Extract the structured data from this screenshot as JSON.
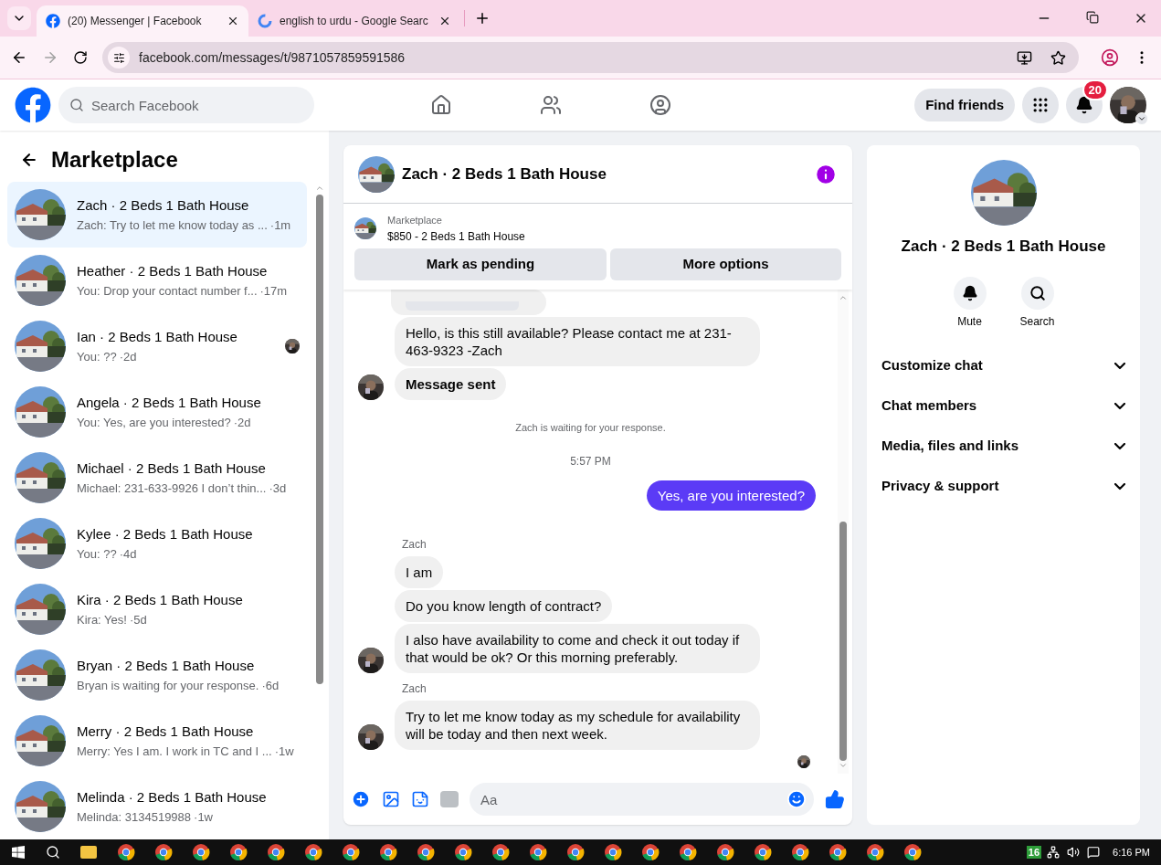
{
  "browser": {
    "tabs": [
      {
        "title": "(20) Messenger | Facebook",
        "selected": true
      },
      {
        "title": "english to urdu - Google Searc",
        "selected": false
      }
    ],
    "url": "facebook.com/messages/t/9871057859591586"
  },
  "header": {
    "search_placeholder": "Search Facebook",
    "find_friends": "Find friends",
    "notification_count": "20"
  },
  "sidebar": {
    "title": "Marketplace",
    "conversations": [
      {
        "name": "Zach · 2 Beds 1 Bath House",
        "preview": "Zach: Try to let me know today as ...",
        "time": "·1m",
        "selected": true,
        "read_receipt": false
      },
      {
        "name": "Heather · 2 Beds 1 Bath House",
        "preview": "You: Drop your contact number f...",
        "time": "·17m",
        "selected": false,
        "read_receipt": false
      },
      {
        "name": "Ian · 2 Beds 1 Bath House",
        "preview": "You: ??",
        "time": "·2d",
        "selected": false,
        "read_receipt": true
      },
      {
        "name": "Angela · 2 Beds 1 Bath House",
        "preview": "You: Yes, are you interested?",
        "time": "·2d",
        "selected": false,
        "read_receipt": false
      },
      {
        "name": "Michael · 2 Beds 1 Bath House",
        "preview": "Michael: 231-633-9926 I don’t thin...",
        "time": "·3d",
        "selected": false,
        "read_receipt": false
      },
      {
        "name": "Kylee · 2 Beds 1 Bath House",
        "preview": "You: ??",
        "time": "·4d",
        "selected": false,
        "read_receipt": false
      },
      {
        "name": "Kira · 2 Beds 1 Bath House",
        "preview": "Kira: Yes!",
        "time": "·5d",
        "selected": false,
        "read_receipt": false
      },
      {
        "name": "Bryan · 2 Beds 1 Bath House",
        "preview": "Bryan is waiting for your response.",
        "time": "·6d",
        "selected": false,
        "read_receipt": false
      },
      {
        "name": "Merry · 2 Beds 1 Bath House",
        "preview": "Merry: Yes I am. I work in TC and I ...",
        "time": "·1w",
        "selected": false,
        "read_receipt": false
      },
      {
        "name": "Melinda · 2 Beds 1 Bath House",
        "preview": "Melinda: 3134519988",
        "time": "·1w",
        "selected": false,
        "read_receipt": false
      }
    ]
  },
  "chat": {
    "title": "Zach · 2 Beds 1 Bath House",
    "listing": {
      "label": "Marketplace",
      "item": "$850 - 2 Beds 1 Bath House"
    },
    "actions": [
      "Mark as pending",
      "More options"
    ],
    "messages": [
      {
        "kind": "cut"
      },
      {
        "kind": "incoming",
        "text": "Hello, is this still available? Please contact me at 231-463-9323 -Zach",
        "avatar": false,
        "bold": false
      },
      {
        "kind": "incoming",
        "text": "Message sent",
        "avatar": true,
        "bold": true
      },
      {
        "kind": "notice",
        "text": "Zach is waiting for your response."
      },
      {
        "kind": "timestamp",
        "text": "5:57 PM"
      },
      {
        "kind": "outgoing",
        "text": "Yes, are you interested?"
      },
      {
        "kind": "sender",
        "text": "Zach"
      },
      {
        "kind": "incoming",
        "text": "I am",
        "avatar": false,
        "bold": false
      },
      {
        "kind": "incoming",
        "text": "Do you know length of contract?",
        "avatar": false,
        "bold": false
      },
      {
        "kind": "incoming",
        "text": "I also have availability to come and check it out today if that would be ok? Or this morning preferably.",
        "avatar": true,
        "bold": false
      },
      {
        "kind": "sender",
        "text": "Zach"
      },
      {
        "kind": "incoming",
        "text": "Try to let me know today as my schedule for availability will be today and then next week.",
        "avatar": true,
        "bold": false
      },
      {
        "kind": "seen"
      }
    ],
    "composer_placeholder": "Aa"
  },
  "details": {
    "title": "Zach · 2 Beds 1 Bath House",
    "actions": [
      "Mute",
      "Search"
    ],
    "sections": [
      {
        "label": "Customize chat",
        "expanded": false
      },
      {
        "label": "Chat members",
        "expanded": false
      },
      {
        "label": "Media, files and links",
        "expanded": false
      },
      {
        "label": "Privacy & support",
        "expanded": false
      }
    ]
  },
  "taskbar": {
    "badge": "16",
    "time": "6:16 PM"
  }
}
